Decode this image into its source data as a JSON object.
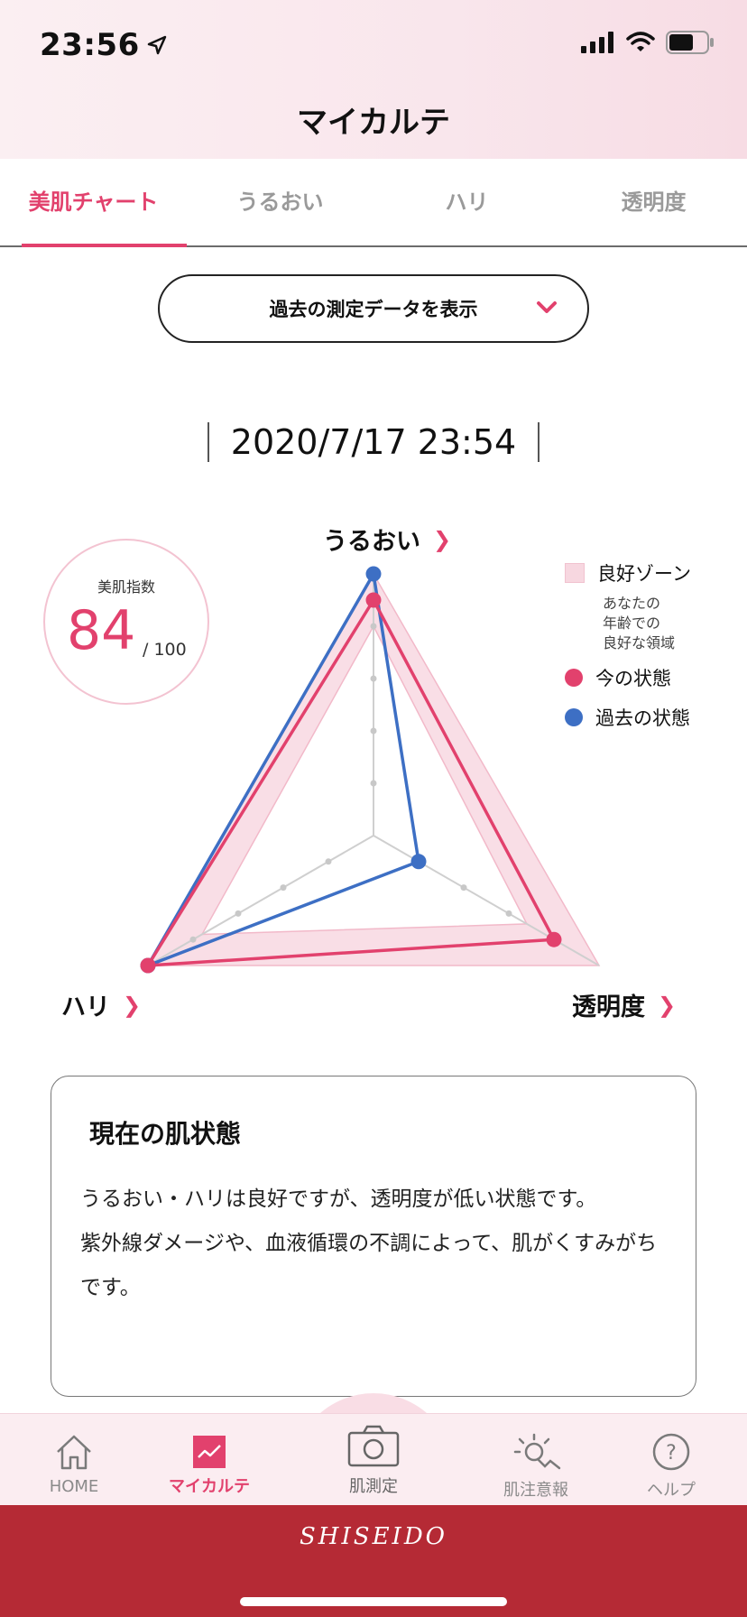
{
  "status": {
    "time": "23:56"
  },
  "header": {
    "title": "マイカルテ"
  },
  "tabs": [
    {
      "label": "美肌チャート",
      "active": true
    },
    {
      "label": "うるおい",
      "active": false
    },
    {
      "label": "ハリ",
      "active": false
    },
    {
      "label": "透明度",
      "active": false
    }
  ],
  "history_button": {
    "label": "過去の測定データを表示"
  },
  "measurement": {
    "datetime": "2020/7/17 23:54"
  },
  "score": {
    "label": "美肌指数",
    "value": "84",
    "max": "/ 100"
  },
  "chart_data": {
    "type": "radar",
    "axes": [
      "うるおい",
      "透明度",
      "ハリ"
    ],
    "scale_max": 5,
    "series": [
      {
        "name": "今の状態",
        "color": "#e2416d",
        "values": [
          4.5,
          4.0,
          5.0
        ]
      },
      {
        "name": "過去の状態",
        "color": "#3d6fc4",
        "values": [
          5.0,
          1.0,
          5.0
        ]
      }
    ],
    "good_zone": {
      "name": "良好ゾーン",
      "min": [
        4.0,
        3.4,
        3.8
      ],
      "max": [
        5.0,
        5.0,
        5.0
      ]
    }
  },
  "axis_labels": {
    "top": "うるおい",
    "left": "ハリ",
    "right": "透明度"
  },
  "legend": {
    "zone_label": "良好ゾーン",
    "zone_desc_1": "あなたの",
    "zone_desc_2": "年齢での",
    "zone_desc_3": "良好な領域",
    "current_label": "今の状態",
    "past_label": "過去の状態"
  },
  "colors": {
    "accent": "#e2416d",
    "past": "#3d6fc4",
    "brand": "#b52a35"
  },
  "status_card": {
    "title": "現在の肌状態",
    "line1": "うるおい・ハリは良好ですが、透明度が低い状態です。",
    "line2": "紫外線ダメージや、血液循環の不調によって、肌がくすみがちです。"
  },
  "nav": {
    "home": "HOME",
    "karte": "マイカルテ",
    "measure": "肌測定",
    "alert": "肌注意報",
    "help": "ヘルプ"
  },
  "brand": {
    "name": "SHISEIDO"
  }
}
